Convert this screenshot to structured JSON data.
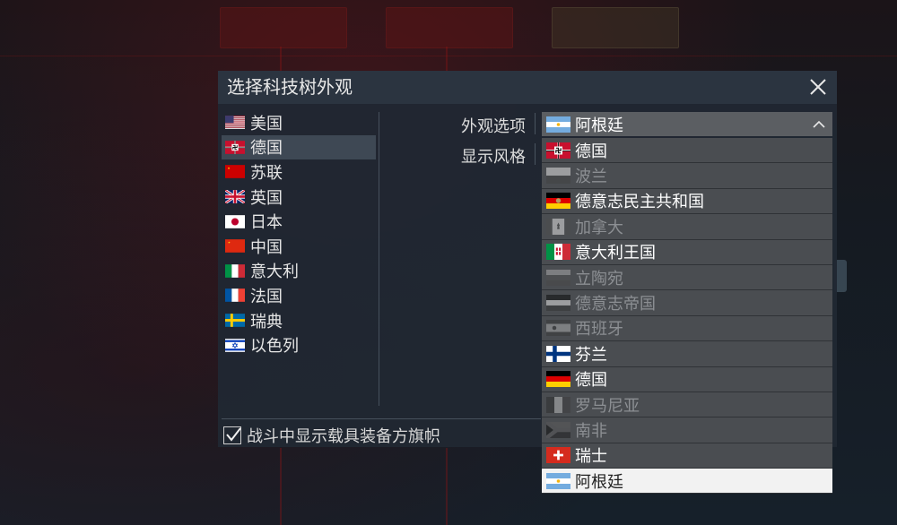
{
  "dialog": {
    "title": "选择科技树外观",
    "close_icon": "close-icon"
  },
  "nations": [
    {
      "label": "美国",
      "flag": "usa-flag-icon",
      "selected": false
    },
    {
      "label": "德国",
      "flag": "germany-nazi-flag-icon",
      "selected": true
    },
    {
      "label": "苏联",
      "flag": "ussr-flag-icon",
      "selected": false
    },
    {
      "label": "英国",
      "flag": "uk-flag-icon",
      "selected": false
    },
    {
      "label": "日本",
      "flag": "japan-flag-icon",
      "selected": false
    },
    {
      "label": "中国",
      "flag": "china-flag-icon",
      "selected": false
    },
    {
      "label": "意大利",
      "flag": "italy-flag-icon",
      "selected": false
    },
    {
      "label": "法国",
      "flag": "france-flag-icon",
      "selected": false
    },
    {
      "label": "瑞典",
      "flag": "sweden-flag-icon",
      "selected": false
    },
    {
      "label": "以色列",
      "flag": "israel-flag-icon",
      "selected": false
    }
  ],
  "options": {
    "appearance_label": "外观选项",
    "style_label": "显示风格",
    "dropdown": {
      "selected": "阿根廷",
      "selected_flag": "argentina-flag-icon",
      "caret_icon": "chevron-up-icon",
      "items": [
        {
          "label": "德国",
          "flag": "germany-nazi-flag-icon",
          "enabled": true
        },
        {
          "label": "波兰",
          "flag": "poland-flag-icon",
          "enabled": false
        },
        {
          "label": "德意志民主共和国",
          "flag": "gdr-flag-icon",
          "enabled": true
        },
        {
          "label": "加拿大",
          "flag": "canada-flag-icon",
          "enabled": false
        },
        {
          "label": "意大利王国",
          "flag": "kingdom-of-italy-flag-icon",
          "enabled": true
        },
        {
          "label": "立陶宛",
          "flag": "lithuania-flag-icon",
          "enabled": false
        },
        {
          "label": "德意志帝国",
          "flag": "german-empire-flag-icon",
          "enabled": false
        },
        {
          "label": "西班牙",
          "flag": "spain-flag-icon",
          "enabled": false
        },
        {
          "label": "芬兰",
          "flag": "finland-flag-icon",
          "enabled": true
        },
        {
          "label": "德国",
          "flag": "germany-flag-icon",
          "enabled": true
        },
        {
          "label": "罗马尼亚",
          "flag": "romania-flag-icon",
          "enabled": false
        },
        {
          "label": "南非",
          "flag": "south-africa-flag-icon",
          "enabled": false
        },
        {
          "label": "瑞士",
          "flag": "switzerland-flag-icon",
          "enabled": true
        },
        {
          "label": "阿根廷",
          "flag": "argentina-flag-icon",
          "enabled": true,
          "selected": true
        }
      ]
    }
  },
  "checkbox": {
    "label": "战斗中显示载具装备方旗帜",
    "checked": true
  }
}
